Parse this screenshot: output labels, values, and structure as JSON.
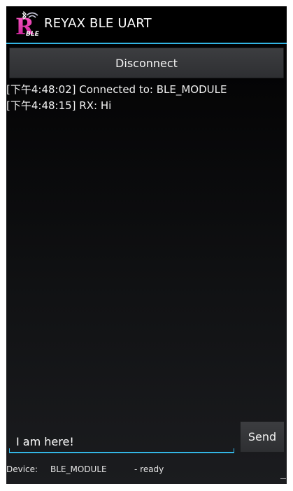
{
  "app": {
    "title": "REYAX BLE UART",
    "icon": "reyax-ble-logo",
    "logo_text": "BLE",
    "accent_color": "#33b5e5"
  },
  "connection": {
    "disconnect_label": "Disconnect"
  },
  "log": {
    "lines": [
      "[下午4:48:02] Connected to: BLE_MODULE",
      "[下午4:48:15] RX: Hi"
    ]
  },
  "composer": {
    "message_value": "I am here!",
    "send_label": "Send"
  },
  "status": {
    "device_label": "Device:",
    "device_name": "BLE_MODULE",
    "state": "- ready"
  }
}
